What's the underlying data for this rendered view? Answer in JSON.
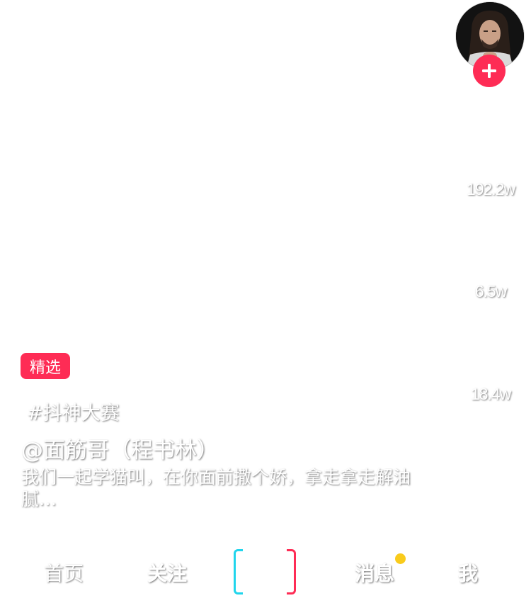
{
  "right_rail": {
    "avatar_icon": "user-avatar",
    "follow_icon": "plus-icon",
    "like_count": "192.2w",
    "comment_count": "6.5w",
    "share_count": "18.4w"
  },
  "caption": {
    "badge": "精选",
    "hashtag": "#抖神大赛",
    "author": "@面筋哥（程书林）",
    "description": "我们一起学猫叫，在你面前撒个娇，拿走拿走解油腻…"
  },
  "bottom_nav": {
    "home": "首页",
    "follow": "关注",
    "messages": "消息",
    "me": "我"
  },
  "colors": {
    "accent": "#fe2c55",
    "cyan": "#20d5ec",
    "notify_dot": "#f9cb1c"
  }
}
